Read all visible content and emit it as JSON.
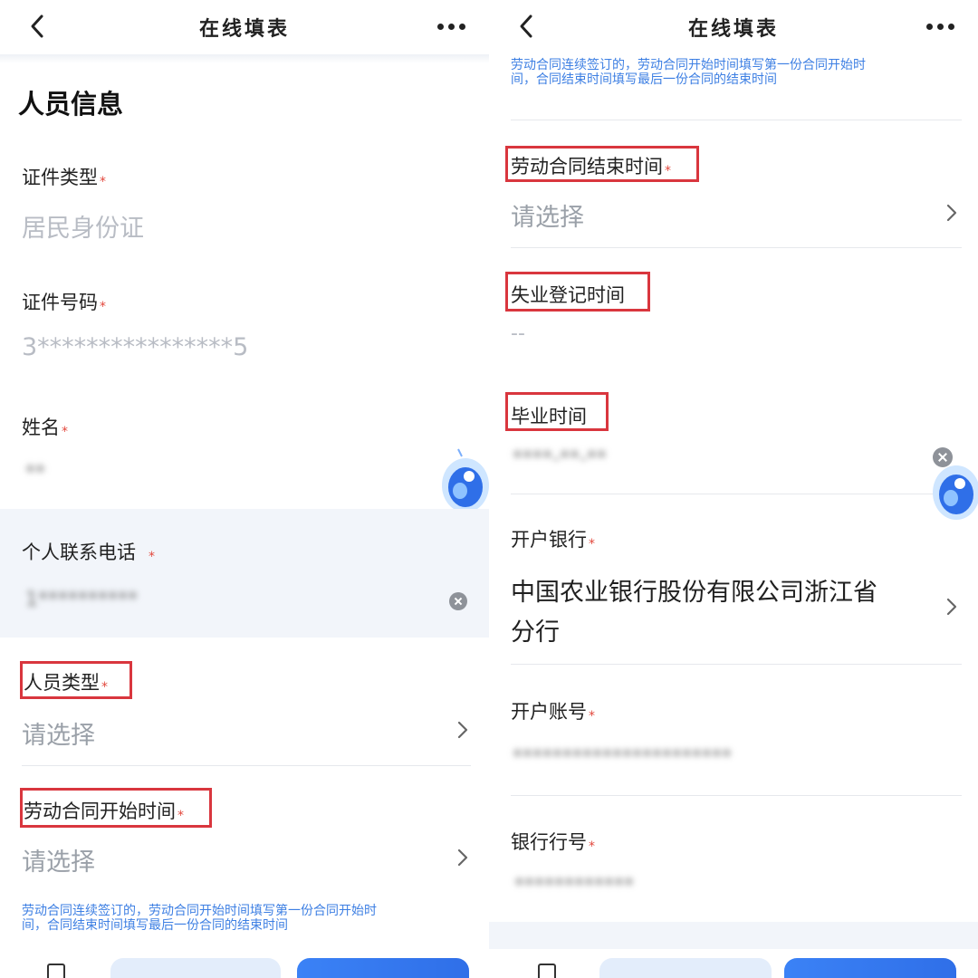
{
  "nav": {
    "title": "在线填表"
  },
  "left": {
    "section_title": "人员信息",
    "id_type": {
      "label": "证件类型",
      "value": "居民身份证"
    },
    "id_number": {
      "label": "证件号码",
      "value": "3****************5"
    },
    "name": {
      "label": "姓名",
      "value": "**"
    },
    "phone": {
      "label": "个人联系电话",
      "value": "1**********"
    },
    "person_type": {
      "label": "人员类型",
      "value": "请选择"
    },
    "contract_start": {
      "label": "劳动合同开始时间",
      "value": "请选择"
    },
    "note_line1": "劳动合同连续签订的，劳动合同开始时间填写第一份合同开始时",
    "note_line2": "间，合同结束时间填写最后一份合同的结束时间"
  },
  "right": {
    "note_line1": "劳动合同连续签订的，劳动合同开始时间填写第一份合同开始时",
    "note_line2": "间，合同结束时间填写最后一份合同的结束时间",
    "contract_end": {
      "label": "劳动合同结束时间",
      "value": "请选择"
    },
    "unemployment_date": {
      "label": "失业登记时间",
      "value": "--"
    },
    "graduation_date": {
      "label": "毕业时间",
      "value": "****-**-**"
    },
    "bank": {
      "label": "开户银行",
      "value_line1": "中国农业银行股份有限公司浙江省",
      "value_line2": "分行"
    },
    "account": {
      "label": "开户账号",
      "value": "**********************"
    },
    "bank_code": {
      "label": "银行行号",
      "value": "************"
    }
  },
  "required_mark": "*",
  "colors": {
    "accent": "#3d7fe3",
    "required": "#e2483d",
    "highlight": "#d9363e"
  }
}
